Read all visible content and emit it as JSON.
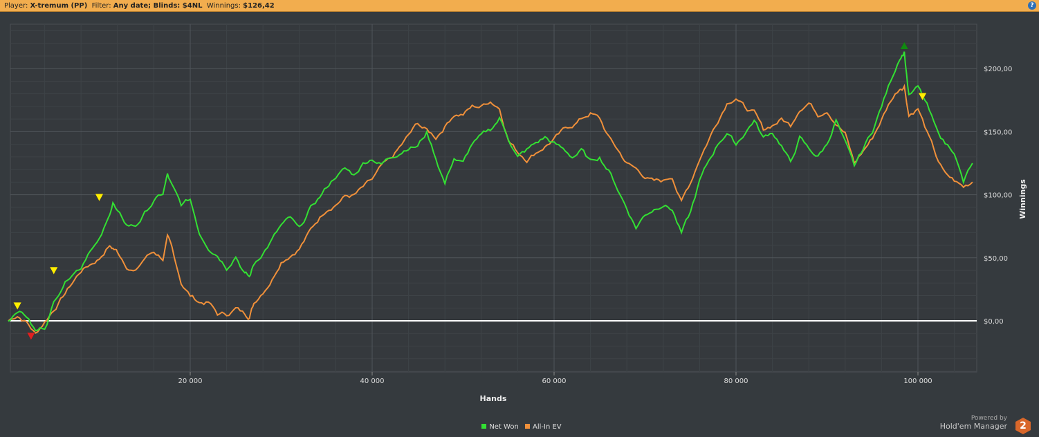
{
  "header": {
    "player_label": "Player:",
    "player": "X-tremum (PP)",
    "filter_label": "Filter:",
    "filter": "Any date; Blinds: $4NL",
    "winnings_label": "Winnings:",
    "winnings": "$126,42",
    "help": "?"
  },
  "branding": {
    "powered_by": "Powered by",
    "product": "Hold'em Manager",
    "logo_text": "2"
  },
  "colors": {
    "net_won": "#33e033",
    "all_in_ev": "#f0903a",
    "zero_line": "#ffffff",
    "background": "#353a3e"
  },
  "chart_data": {
    "type": "line",
    "xlabel": "Hands",
    "ylabel": "Winnings",
    "xlim": [
      0,
      106500
    ],
    "ylim": [
      -40,
      236
    ],
    "x_ticks": [
      20000,
      40000,
      60000,
      80000,
      100000
    ],
    "x_tick_labels": [
      "20 000",
      "40 000",
      "60 000",
      "80 000",
      "100 000"
    ],
    "y_ticks": [
      0,
      50,
      100,
      150,
      200
    ],
    "y_tick_labels": [
      "$0,00",
      "$50,00",
      "$100,00",
      "$150,00",
      "$200,00"
    ],
    "grid": true,
    "legend": "bottom-center",
    "x_thousands": [
      0,
      1,
      2,
      3,
      4,
      5,
      6,
      7,
      8,
      9,
      10,
      11,
      11.5,
      12,
      13,
      14,
      15,
      16,
      17,
      17.5,
      18,
      19,
      20,
      21,
      22,
      23,
      24,
      25,
      26,
      26.5,
      27,
      28,
      29,
      30,
      31,
      32,
      33,
      34,
      35,
      36,
      37,
      38,
      39,
      40,
      41,
      42,
      43,
      44,
      45,
      46,
      47,
      48,
      49,
      50,
      51,
      52,
      53,
      54,
      55,
      56,
      57,
      58,
      59,
      60,
      61,
      62,
      63,
      64,
      65,
      66,
      67,
      68,
      69,
      70,
      71,
      72,
      73,
      74,
      75,
      76,
      77,
      78,
      79,
      80,
      81,
      82,
      83,
      84,
      85,
      86,
      87,
      88,
      89,
      90,
      91,
      92,
      93,
      94,
      95,
      96,
      97,
      98,
      98.5,
      99,
      100,
      101,
      102,
      103,
      104,
      105,
      106
    ],
    "series": [
      {
        "name": "Net Won",
        "values": [
          0,
          10,
          5,
          -8,
          -5,
          15,
          30,
          40,
          45,
          60,
          65,
          80,
          95,
          85,
          75,
          75,
          85,
          95,
          100,
          115,
          105,
          90,
          95,
          70,
          60,
          55,
          45,
          55,
          40,
          35,
          45,
          55,
          65,
          75,
          80,
          70,
          85,
          95,
          105,
          115,
          120,
          115,
          125,
          130,
          125,
          130,
          135,
          140,
          140,
          150,
          130,
          110,
          130,
          125,
          140,
          145,
          150,
          160,
          145,
          130,
          135,
          140,
          145,
          140,
          135,
          130,
          135,
          125,
          130,
          120,
          105,
          90,
          75,
          85,
          90,
          95,
          90,
          70,
          85,
          110,
          125,
          140,
          150,
          140,
          150,
          160,
          145,
          150,
          140,
          125,
          145,
          135,
          130,
          140,
          160,
          140,
          120,
          135,
          150,
          170,
          190,
          210,
          215,
          180,
          185,
          170,
          150,
          140,
          135,
          110,
          125
        ]
      },
      {
        "name": "All-In EV",
        "values": [
          0,
          5,
          0,
          -10,
          0,
          10,
          20,
          30,
          40,
          45,
          50,
          60,
          58,
          55,
          45,
          40,
          50,
          55,
          50,
          65,
          55,
          30,
          20,
          15,
          15,
          5,
          5,
          10,
          5,
          5,
          15,
          25,
          35,
          50,
          55,
          60,
          70,
          80,
          90,
          95,
          100,
          100,
          105,
          110,
          120,
          125,
          135,
          145,
          155,
          150,
          145,
          155,
          165,
          165,
          170,
          170,
          175,
          170,
          145,
          135,
          130,
          135,
          140,
          145,
          150,
          155,
          160,
          165,
          160,
          145,
          135,
          125,
          120,
          115,
          110,
          110,
          115,
          95,
          110,
          130,
          145,
          160,
          175,
          180,
          170,
          165,
          150,
          155,
          160,
          155,
          170,
          175,
          165,
          170,
          160,
          150,
          125,
          135,
          145,
          160,
          175,
          185,
          188,
          165,
          170,
          150,
          130,
          115,
          110,
          105,
          110
        ]
      }
    ],
    "markers": [
      {
        "type": "star",
        "color": "#ffee00",
        "hands": 1000,
        "value": 12
      },
      {
        "type": "star",
        "color": "#ffee00",
        "hands": 5000,
        "value": 40
      },
      {
        "type": "star",
        "color": "#ffee00",
        "hands": 10000,
        "value": 98
      },
      {
        "type": "star",
        "color": "#ffee00",
        "hands": 100500,
        "value": 178
      },
      {
        "type": "triangle-down",
        "color": "#e02020",
        "hands": 2500,
        "value": -12
      },
      {
        "type": "triangle-up",
        "color": "#108a10",
        "hands": 98500,
        "value": 218
      }
    ]
  }
}
